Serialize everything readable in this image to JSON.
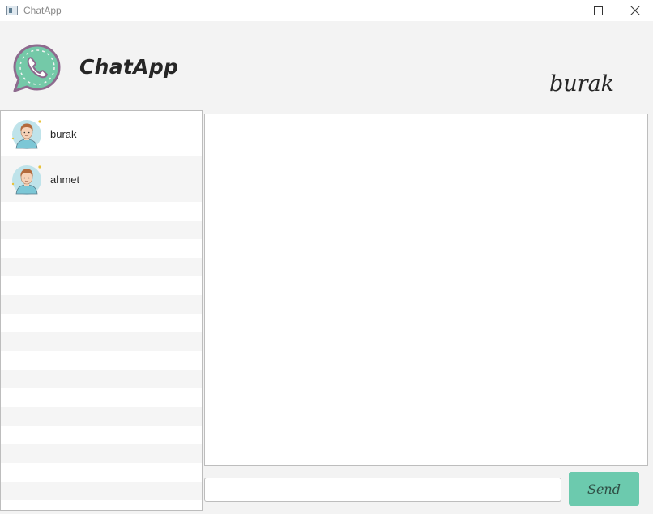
{
  "window": {
    "title": "ChatApp",
    "controls": [
      "minimize-icon",
      "maximize-icon",
      "close-icon"
    ]
  },
  "header": {
    "logo_icon": "phone-chat-bubble-icon",
    "app_title": "ChatApp",
    "current_user": "burak"
  },
  "contacts": [
    {
      "name": "burak",
      "avatar": "user-avatar-icon"
    },
    {
      "name": "ahmet",
      "avatar": "user-avatar-icon"
    }
  ],
  "message_input": {
    "value": "",
    "placeholder": ""
  },
  "send_button": {
    "label": "Send"
  },
  "colors": {
    "accent": "#6ccaae",
    "logo_green": "#74c9a8",
    "logo_outline": "#8e6a8e",
    "background": "#f3f3f3",
    "list_stripe": "#f5f5f5"
  }
}
